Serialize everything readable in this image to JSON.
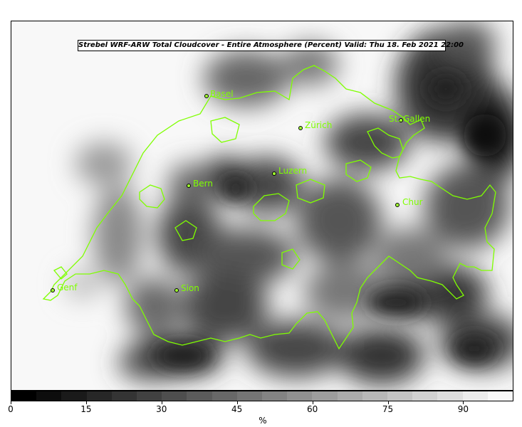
{
  "title": "Strebel WRF-ARW Total Cloudcover - Entire Atmosphere (Percent)   Valid: Thu 18. Feb 2021 22:00",
  "cities": [
    {
      "name": "Basel"
    },
    {
      "name": "Zürich"
    },
    {
      "name": "St. Gallen"
    },
    {
      "name": "Luzern"
    },
    {
      "name": "Bern"
    },
    {
      "name": "Chur"
    },
    {
      "name": "Genf"
    },
    {
      "name": "Sion"
    }
  ],
  "colorbar": {
    "min": 0,
    "max": 100,
    "step": 5,
    "ticks": [
      "0",
      "15",
      "30",
      "45",
      "60",
      "75",
      "90"
    ],
    "unit": "%"
  },
  "colors": {
    "border_line": "#7fff00",
    "label": "#7fff00",
    "low_cloud": "#000000",
    "high_cloud": "#f8f8f8"
  }
}
